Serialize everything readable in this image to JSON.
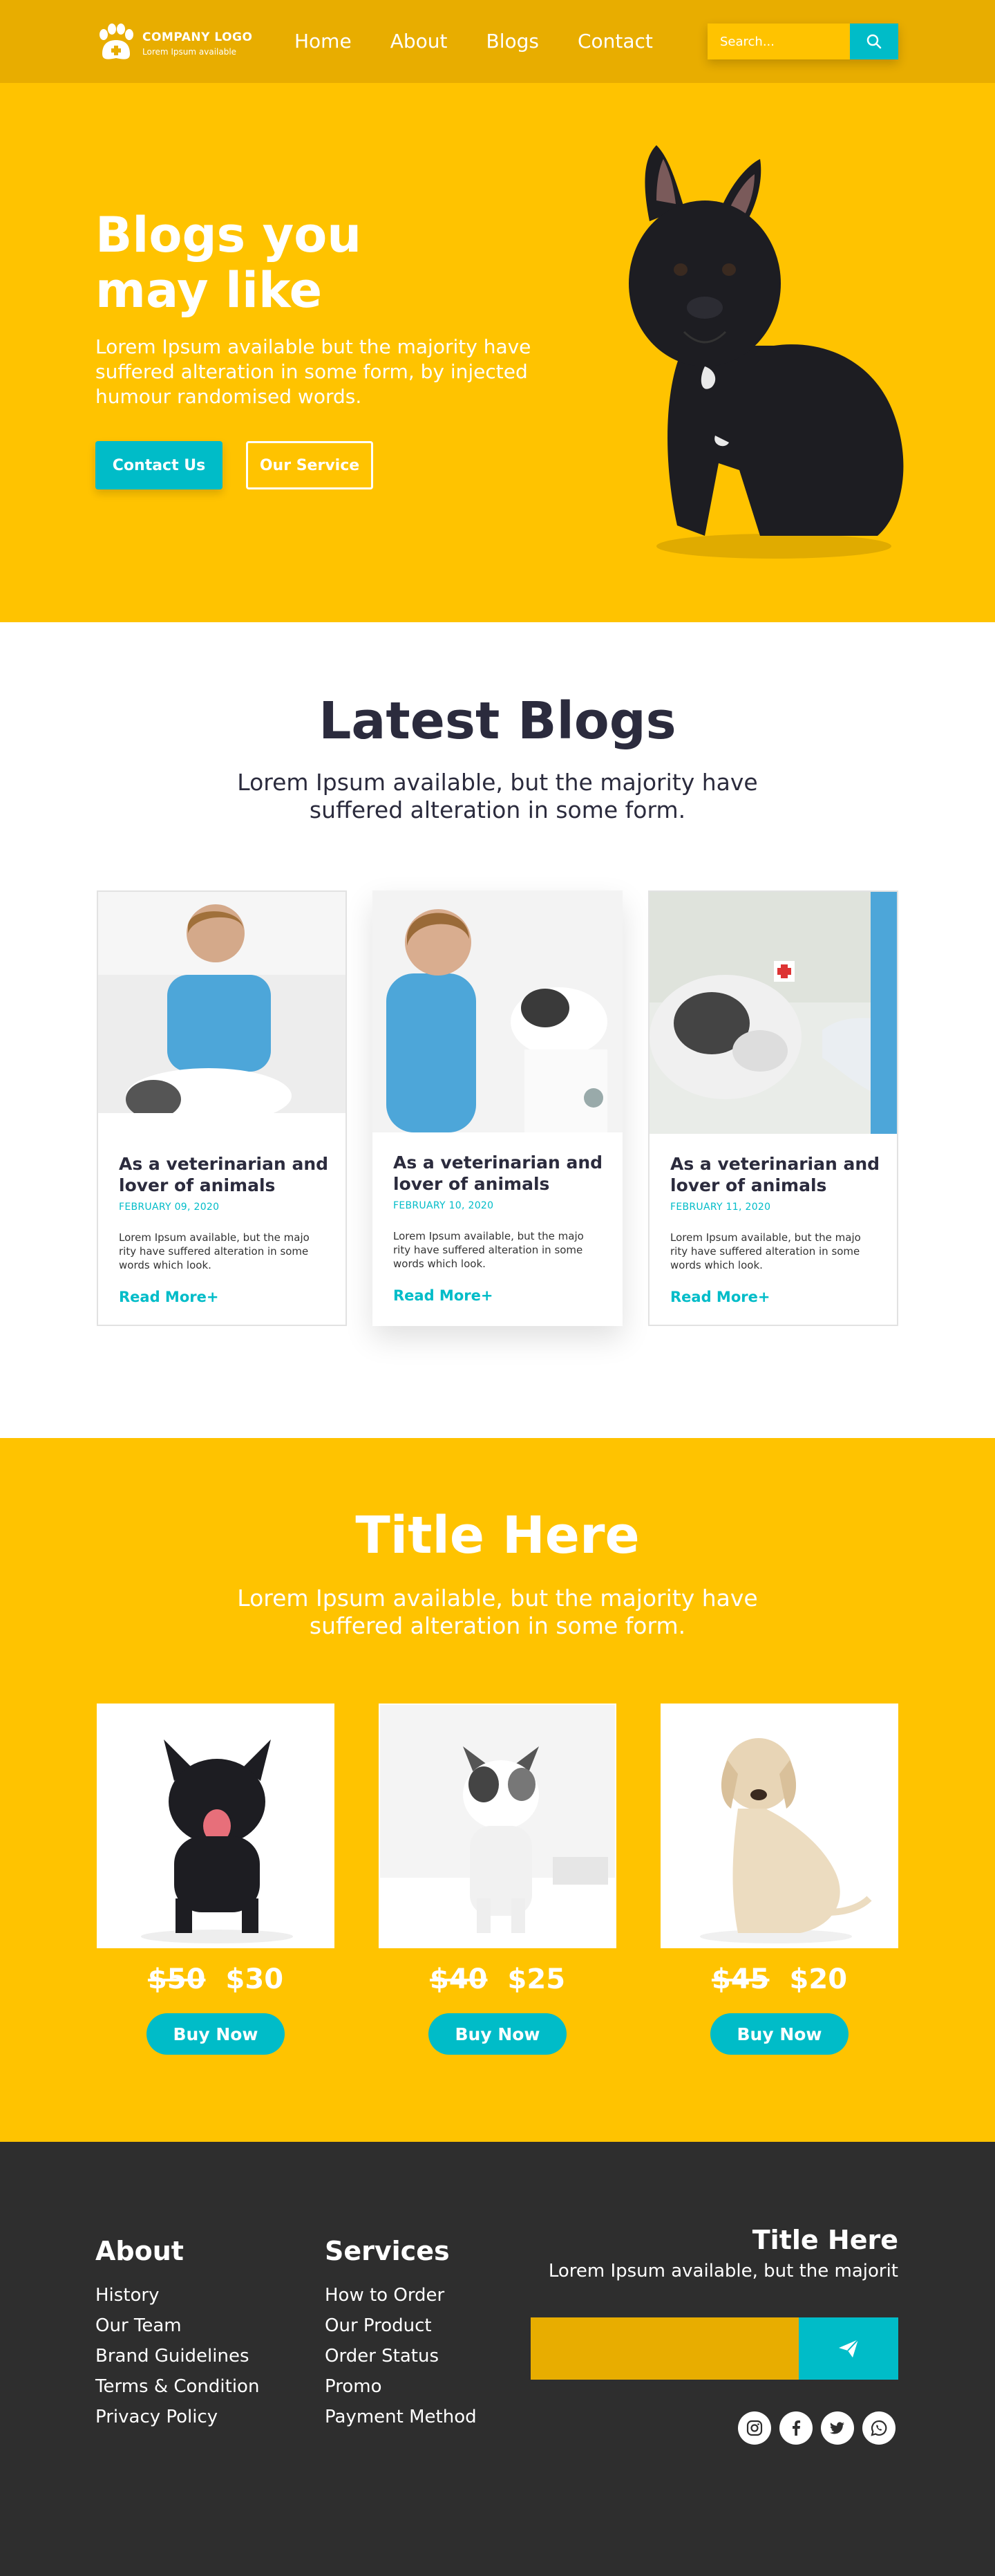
{
  "nav": {
    "logo_title": "COMPANY LOGO",
    "logo_subtitle": "Lorem Ipsum available",
    "menu": [
      "Home",
      "About",
      "Blogs",
      "Contact"
    ],
    "search_placeholder": "Search..."
  },
  "hero": {
    "title": "Blogs you\nmay like",
    "subtitle": "Lorem Ipsum available but the majority have suffered alteration in some form, by injected humour randomised words.",
    "contact_button": "Contact Us",
    "service_button": "Our Service"
  },
  "blogs": {
    "title": "Latest Blogs",
    "subtitle": "Lorem Ipsum available, but the majority have suffered alteration in some form.",
    "cards": [
      {
        "title": "As a veterinarian and lover of animals",
        "date": "FEBRUARY 09, 2020",
        "text": "Lorem Ipsum available, but the majo rity have suffered alteration in some words which look.",
        "link": "Read More+"
      },
      {
        "title": "As a veterinarian and lover of animals",
        "date": "FEBRUARY 10, 2020",
        "text": "Lorem Ipsum available, but the majo rity have suffered alteration in some words which look.",
        "link": "Read More+"
      },
      {
        "title": "As a veterinarian and lover of animals",
        "date": "FEBRUARY 11, 2020",
        "text": "Lorem Ipsum available, but the majo rity have suffered alteration in some words which look.",
        "link": "Read More+"
      }
    ]
  },
  "products": {
    "title": "Title Here",
    "subtitle": "Lorem Ipsum available, but the majority have suffered alteration in some form.",
    "items": [
      {
        "old_price": "$50",
        "new_price": "$30",
        "button": "Buy Now"
      },
      {
        "old_price": "$40",
        "new_price": "$25",
        "button": "Buy Now"
      },
      {
        "old_price": "$45",
        "new_price": "$20",
        "button": "Buy Now"
      }
    ]
  },
  "footer": {
    "about_title": "About",
    "about_links": [
      "History",
      "Our Team",
      "Brand Guidelines",
      "Terms & Condition",
      "Privacy Policy"
    ],
    "services_title": "Services",
    "services_links": [
      "How to Order",
      "Our Product",
      "Order Status",
      "Promo",
      "Payment Method"
    ],
    "newsletter_title": "Title Here",
    "newsletter_text": "Lorem Ipsum available, but the majorit",
    "social_icons": [
      "instagram-icon",
      "facebook-icon",
      "twitter-icon",
      "whatsapp-icon"
    ]
  },
  "colors": {
    "primary_yellow": "#ffc300",
    "dark_yellow": "#e8ad00",
    "accent_teal": "#00bcc8",
    "heading_navy": "#2b2b3d",
    "footer_bg": "#2e2e2e"
  }
}
